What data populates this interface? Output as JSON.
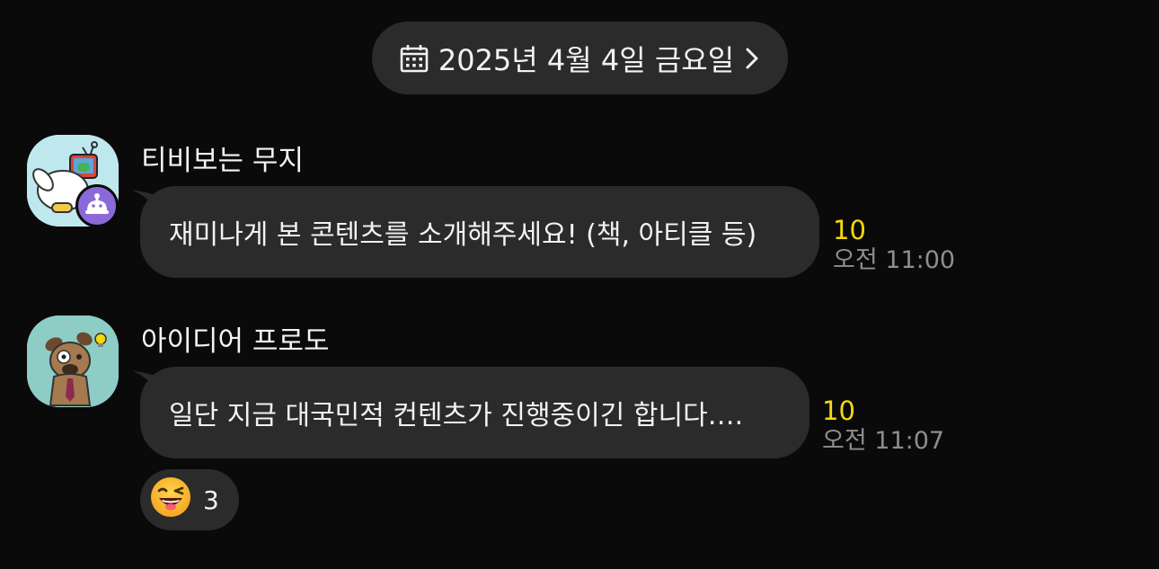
{
  "date_divider": {
    "label": "2025년 4월 4일 금요일",
    "icon": "calendar-icon",
    "chevron": "chevron-right-icon"
  },
  "messages": [
    {
      "sender": "티비보는 무지",
      "avatar_icon": "muzi-watching-tv-avatar",
      "bot_badge_icon": "bot-icon",
      "text": "재미나게 본 콘텐츠를 소개해주세요! (책, 아티클 등)",
      "unread_count": "10",
      "time": "오전 11:00"
    },
    {
      "sender": "아이디어 프로도",
      "avatar_icon": "frodo-idea-avatar",
      "text": "일단 지금 대국민적 컨텐츠가 진행중이긴 합니다….",
      "unread_count": "10",
      "time": "오전 11:07",
      "reaction": {
        "icon": "grinning-emoji-icon",
        "count": "3"
      }
    }
  ],
  "colors": {
    "background": "#0a0a0a",
    "bubble": "#2b2b2b",
    "unread": "#f5d90a",
    "time": "#8e8e8e",
    "bot_badge": "#8a6ad9",
    "avatar_bg_1": "#bfe8ee",
    "avatar_bg_2": "#8ecdc6"
  }
}
